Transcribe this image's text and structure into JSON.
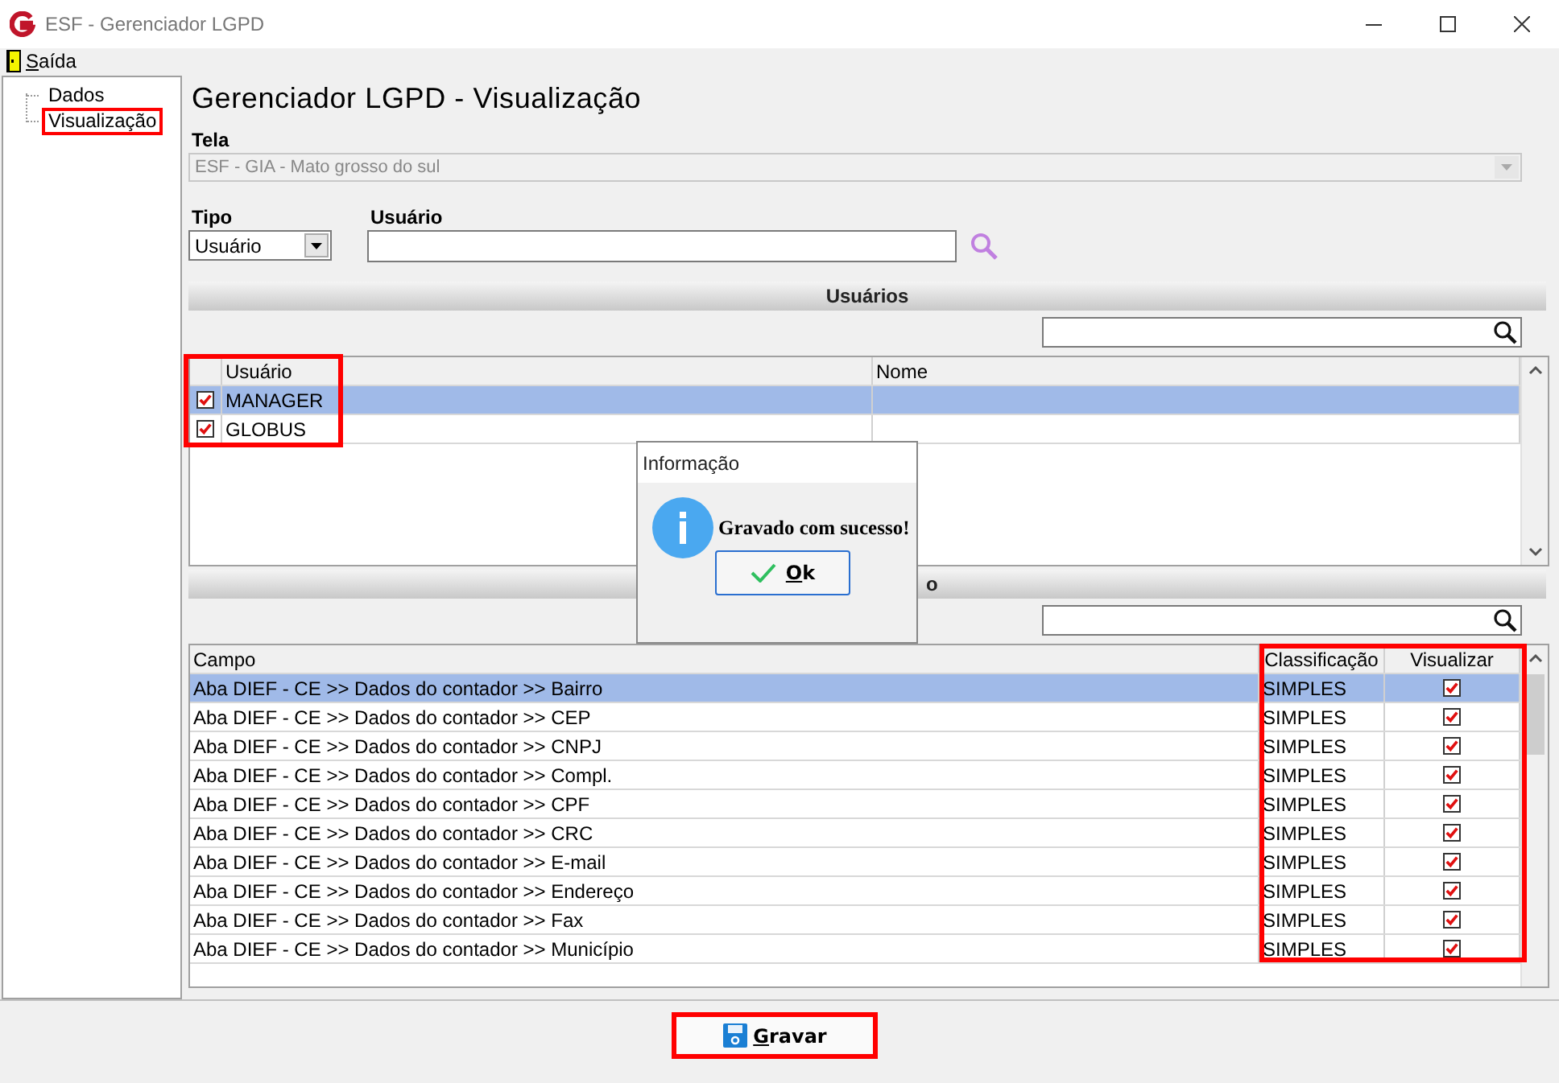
{
  "window": {
    "title": "ESF - Gerenciador LGPD"
  },
  "menu": [
    {
      "label": "Saída"
    }
  ],
  "tree": [
    {
      "label": "Dados",
      "highlighted": false
    },
    {
      "label": "Visualização",
      "highlighted": true
    }
  ],
  "heading": "Gerenciador LGPD - Visualização",
  "tela": {
    "label": "Tela",
    "value": "ESF - GIA - Mato grosso do sul"
  },
  "tipo": {
    "label": "Tipo",
    "value": "Usuário"
  },
  "usuario_field": {
    "label": "Usuário"
  },
  "users_section": {
    "title": "Usuários",
    "highlighted": true,
    "columns": [
      "Usuário",
      "Nome"
    ],
    "rows": [
      {
        "checked": true,
        "user": "MANAGER",
        "selected": true
      },
      {
        "checked": true,
        "user": "GLOBUS",
        "selected": false
      }
    ]
  },
  "fields_section": {
    "title": "o",
    "highlighted": true,
    "columns": [
      "Campo",
      "Classificação",
      "Visualizar"
    ],
    "rows": [
      {
        "campo": "Aba DIEF - CE >> Dados do contador >> Bairro",
        "classificacao": "SIMPLES",
        "visualizar": true,
        "selected": true
      },
      {
        "campo": "Aba DIEF - CE >> Dados do contador >> CEP",
        "classificacao": "SIMPLES",
        "visualizar": true,
        "selected": false
      },
      {
        "campo": "Aba DIEF - CE >> Dados do contador >> CNPJ",
        "classificacao": "SIMPLES",
        "visualizar": true,
        "selected": false
      },
      {
        "campo": "Aba DIEF - CE >> Dados do contador >> Compl.",
        "classificacao": "SIMPLES",
        "visualizar": true,
        "selected": false
      },
      {
        "campo": "Aba DIEF - CE >> Dados do contador >> CPF",
        "classificacao": "SIMPLES",
        "visualizar": true,
        "selected": false
      },
      {
        "campo": "Aba DIEF - CE >> Dados do contador >> CRC",
        "classificacao": "SIMPLES",
        "visualizar": true,
        "selected": false
      },
      {
        "campo": "Aba DIEF - CE >> Dados do contador >> E-mail",
        "classificacao": "SIMPLES",
        "visualizar": true,
        "selected": false
      },
      {
        "campo": "Aba DIEF - CE >> Dados do contador >> Endereço",
        "classificacao": "SIMPLES",
        "visualizar": true,
        "selected": false
      },
      {
        "campo": "Aba DIEF - CE >> Dados do contador >> Fax",
        "classificacao": "SIMPLES",
        "visualizar": true,
        "selected": false
      },
      {
        "campo": "Aba DIEF - CE >> Dados do contador >> Município",
        "classificacao": "SIMPLES",
        "visualizar": true,
        "selected": false
      }
    ]
  },
  "save_button": {
    "label": "Gravar",
    "highlighted": true
  },
  "dialog": {
    "title": "Informação",
    "message": "Gravado com sucesso!",
    "button": "Ok"
  }
}
